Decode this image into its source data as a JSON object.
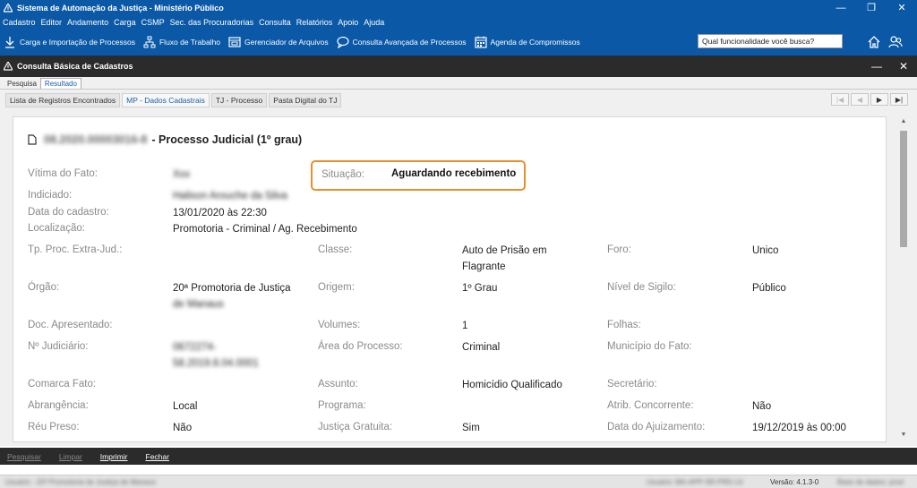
{
  "window": {
    "title": "Sistema de Automação da Justiça - Ministério Público"
  },
  "menu": [
    "Cadastro",
    "Editor",
    "Andamento",
    "Carga",
    "CSMP",
    "Sec. das Procuradorias",
    "Consulta",
    "Relatórios",
    "Apoio",
    "Ajuda"
  ],
  "toolbar": {
    "items": [
      {
        "label": "Carga e Importação de Processos",
        "icon": "download-icon"
      },
      {
        "label": "Fluxo de Trabalho",
        "icon": "workflow-icon"
      },
      {
        "label": "Gerenciador de Arquivos",
        "icon": "file-manager-icon"
      },
      {
        "label": "Consulta Avançada de Processos",
        "icon": "search-chat-icon"
      },
      {
        "label": "Agenda de Compromissos",
        "icon": "calendar-icon"
      }
    ],
    "search_value": "Qual funcionalidade você busca?"
  },
  "inner_window": {
    "title": "Consulta Básica de Cadastros"
  },
  "tabs_top": [
    "Pesquisa",
    "Resultado"
  ],
  "tabs_second": [
    "Lista de Registros Encontrados",
    "MP - Dados Cadastrais",
    "TJ - Processo",
    "Pasta Digital do TJ"
  ],
  "record": {
    "number": "08.2020.00003016-8",
    "title": "- Processo Judicial (1º grau)",
    "situacao_label": "Situação:",
    "situacao_value": "Aguardando recebimento",
    "vitima_label": "Vítima do Fato:",
    "vitima_value": "Xxx",
    "indiciado_label": "Indiciado:",
    "indiciado_value": "Halison Arouche da Silva",
    "cadastro_label": "Data do cadastro:",
    "cadastro_value": "13/01/2020 às 22:30",
    "localizacao_label": "Localização:",
    "localizacao_value": "Promotoria - Criminal / Ag. Recebimento"
  },
  "grid": {
    "c1": [
      {
        "label": "Tp. Proc. Extra-Jud.:",
        "value": ""
      },
      {
        "label": "Órgão:",
        "value": "20ª Promotoria de Justiça",
        "value2": "de Manaus"
      },
      {
        "label": "Doc. Apresentado:",
        "value": ""
      },
      {
        "label": "Nº Judiciário:",
        "value": "0672274-",
        "value2": "58.2019.8.04.0001"
      },
      {
        "label": "Comarca Fato:",
        "value": ""
      },
      {
        "label": "Abrangência:",
        "value": "Local"
      },
      {
        "label": "Réu Preso:",
        "value": "Não"
      }
    ],
    "c2": [
      {
        "label": "Classe:",
        "value": "Auto de Prisão em",
        "value2": "Flagrante"
      },
      {
        "label": "Origem:",
        "value": "1º Grau"
      },
      {
        "label": "Volumes:",
        "value": "1"
      },
      {
        "label": "Área do Processo:",
        "value": "Criminal"
      },
      {
        "label": "Assunto:",
        "value": "Homicídio Qualificado"
      },
      {
        "label": "Programa:",
        "value": ""
      },
      {
        "label": "Justiça Gratuita:",
        "value": "Sim"
      }
    ],
    "c3": [
      {
        "label": "Foro:",
        "value": "Unico"
      },
      {
        "label": "Nível de Sigilo:",
        "value": "Público"
      },
      {
        "label": "Folhas:",
        "value": ""
      },
      {
        "label": "Município do Fato:",
        "value": ""
      },
      {
        "label": "Secretário:",
        "value": ""
      },
      {
        "label": "Atrib. Concorrente:",
        "value": "Não"
      },
      {
        "label": "Data do Ajuizamento:",
        "value": "19/12/2019 às 00:00"
      }
    ]
  },
  "commands": [
    "Pesquisar",
    "Limpar",
    "Imprimir",
    "Fechar"
  ],
  "status": {
    "left": "Usuário - 20ª Promotoria de Justiça de Manaus",
    "mid": "Usuário: MA-APP-SR-PRD-14",
    "version": "Versão: 4.1.3-0",
    "right": "Base de dados: prod"
  },
  "colors": {
    "brand_blue": "#0a58a6",
    "header_dark": "#2b2b2b",
    "highlight_orange": "#e8902a"
  }
}
